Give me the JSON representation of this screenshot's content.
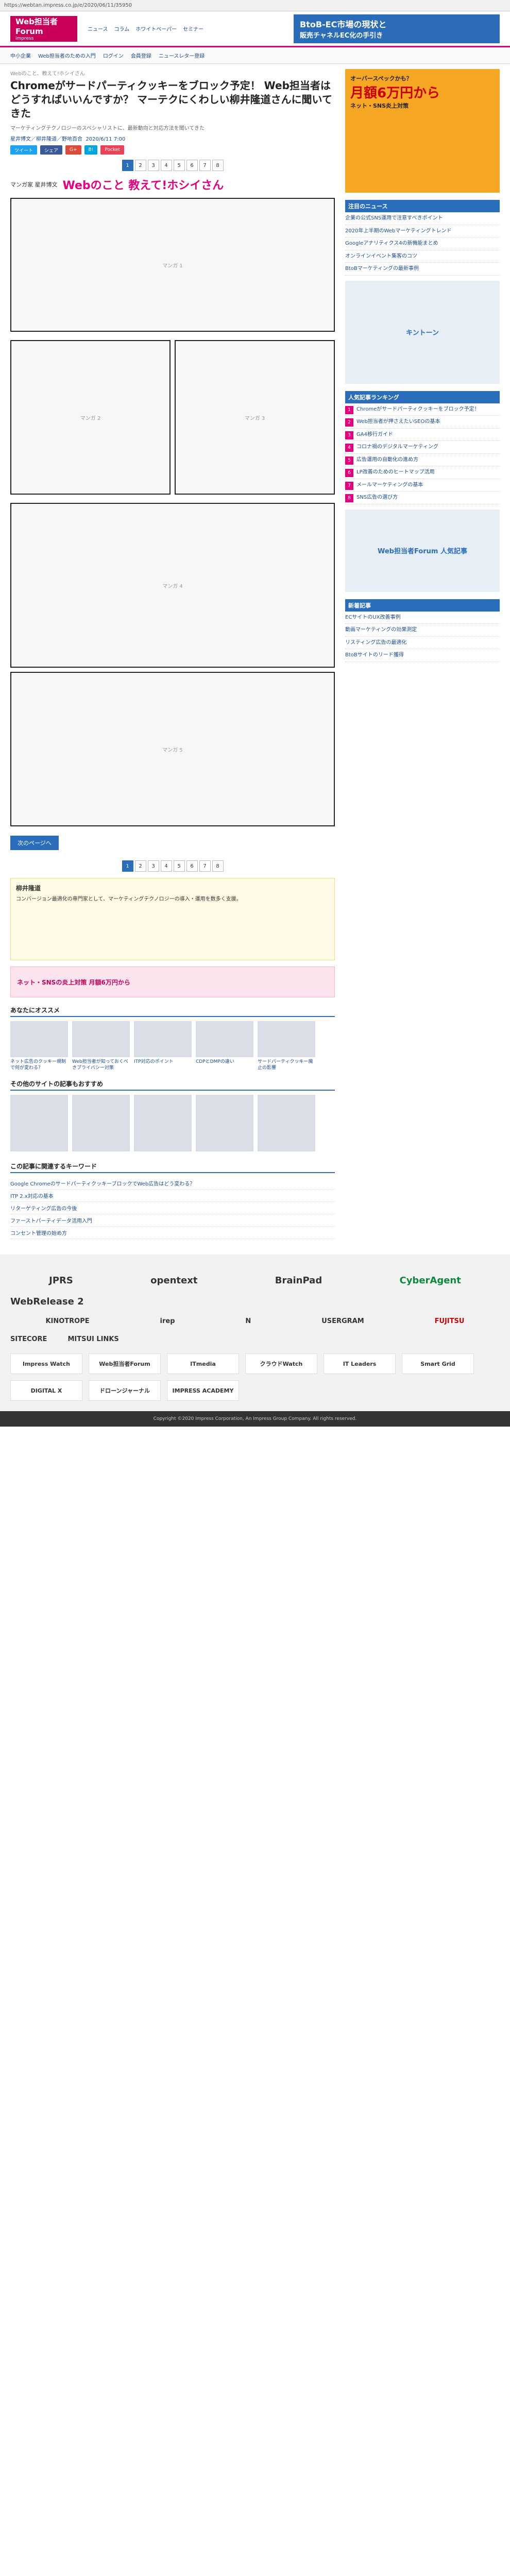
{
  "address": "https://webtan.impress.co.jp/e/2020/06/11/35950",
  "header": {
    "logo": "Web担当者Forum",
    "logo_sub": "impress",
    "nav": [
      "ニュース",
      "コラム",
      "ホワイトペーパー",
      "セミナー"
    ],
    "banner_line1": "BtoB-EC市場の現状と",
    "banner_line2": "販売チャネルEC化の手引き"
  },
  "subnav": [
    "中小企業",
    "Web担当者のための入門",
    "ログイン",
    "会員登録",
    "ニュースレター登録"
  ],
  "article": {
    "crumb": "Webのこと、教えて!ホシイさん",
    "title": "Chromeがサードパーティクッキーをブロック予定！ Web担当者はどうすればいいんですか？ マーテクにくわしい柳井隆道さんに聞いてきた",
    "lead": "マーケティングテクノロジーのスペシャリストに、最新動向と対応方法を聞いてきた",
    "authors": "星井博文／柳井隆道／野地百合",
    "date": "2020/6/11 7:00",
    "manga_title": "Webのこと 教えて!ホシイさん",
    "manga_author": "マンガ家 星井博文",
    "panels": [
      "マンガ 1",
      "マンガ 2",
      "マンガ 3",
      "マンガ 4",
      "マンガ 5"
    ],
    "next_label": "次のページへ",
    "pages": [
      "1",
      "2",
      "3",
      "4",
      "5",
      "6",
      "7",
      "8"
    ]
  },
  "share": {
    "tw": "ツイート",
    "fb": "シェア",
    "gp": "G+",
    "hb": "B!",
    "pk": "Pocket"
  },
  "profile": {
    "heading": "柳井隆道",
    "text": "コンバージョン最適化の専門家として、マーケティングテクノロジーの導入・運用を数多く支援。"
  },
  "related": {
    "heading": "あなたにオススメ",
    "items": [
      "ネット広告のクッキー規制で何が変わる？",
      "Web担当者が知っておくべきプライバシー対策",
      "ITP対応のポイント",
      "CDPとDMPの違い",
      "サードパーティクッキー廃止の影響"
    ]
  },
  "recommend_heading": "その他のサイトの記事もおすすめ",
  "list_heading": "この記事に関連するキーワード",
  "list": [
    "Google ChromeのサードパーティクッキーブロックでWeb広告はどう変わる？",
    "ITP 2.x対応の基本",
    "リターゲティング広告の今後",
    "ファーストパーティデータ活用入門",
    "コンセント管理の始め方"
  ],
  "ad_pink": "ネット・SNSの炎上対策 月額6万円から",
  "side": {
    "ad_title": "オーバースペックかも？",
    "ad_price": "月額6万円から",
    "ad_sub": "ネット・SNS炎上対策",
    "news_heading": "注目のニュース",
    "news": [
      "企業の公式SNS運用で注意すべきポイント",
      "2020年上半期のWebマーケティングトレンド",
      "Googleアナリティクス4の新機能まとめ",
      "オンラインイベント集客のコツ",
      "BtoBマーケティングの最新事例"
    ],
    "banner1": "キントーン",
    "ranking_heading": "人気記事ランキング",
    "ranking": [
      "Chromeがサードパーティクッキーをブロック予定！",
      "Web担当者が押さえたいSEOの基本",
      "GA4移行ガイド",
      "コロナ禍のデジタルマーケティング",
      "広告運用の自動化の進め方",
      "LP改善のためのヒートマップ活用",
      "メールマーケティングの基本",
      "SNS広告の選び方"
    ],
    "banner2": "Web担当者Forum 人気記事",
    "new_heading": "新着記事",
    "new_items": [
      "ECサイトのUX改善事例",
      "動画マーケティングの効果測定",
      "リスティング広告の最適化",
      "BtoBサイトのリード獲得"
    ]
  },
  "sponsors": [
    "JPRS",
    "opentext",
    "BrainPad",
    "CyberAgent"
  ],
  "webrelease": "WebRelease 2",
  "partners": [
    "KINOTROPE",
    "irep",
    "N",
    "USERGRAM",
    "FUJITSU",
    "SITECORE",
    "MITSUI LINKS"
  ],
  "footer_logos": [
    "Impress Watch",
    "Web担当者Forum",
    "ITmedia",
    "クラウドWatch",
    "IT Leaders",
    "Smart Grid",
    "DIGITAL X",
    "ドローンジャーナル",
    "IMPRESS ACADEMY"
  ],
  "copyright": "Copyright ©2020 Impress Corporation, An Impress Group Company. All rights reserved."
}
